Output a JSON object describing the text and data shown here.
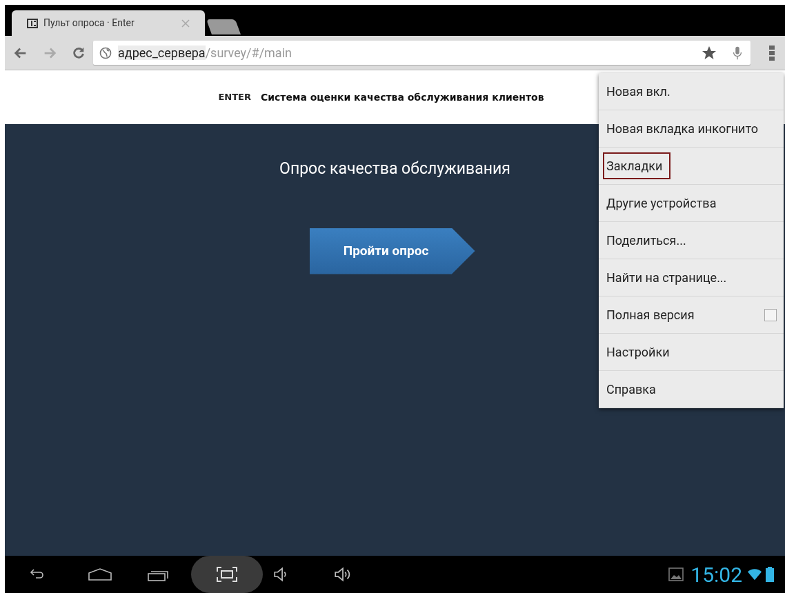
{
  "browser": {
    "tabs": [
      {
        "title": "Пульт опроса · Enter",
        "selected": true
      }
    ],
    "address": {
      "host": "адрес_сервера",
      "path": "/survey/#/main"
    }
  },
  "page": {
    "logo": "ENTER",
    "header": "Система оценки качества обслуживания клиентов",
    "title": "Опрос качества обслуживания",
    "start_button": "Пройти опрос"
  },
  "menu": {
    "items": [
      {
        "label": "Новая вкл.",
        "kind": "plain",
        "selected": false
      },
      {
        "label": "Новая вкладка инкогнито",
        "kind": "plain",
        "selected": false
      },
      {
        "label": "Закладки",
        "kind": "plain",
        "selected": true
      },
      {
        "label": "Другие устройства",
        "kind": "plain",
        "selected": false
      },
      {
        "label": "Поделиться...",
        "kind": "plain",
        "selected": false
      },
      {
        "label": "Найти на странице...",
        "kind": "plain",
        "selected": false
      },
      {
        "label": "Полная версия",
        "kind": "checkbox",
        "selected": false,
        "checked": false
      },
      {
        "label": "Настройки",
        "kind": "plain",
        "selected": false
      },
      {
        "label": "Справка",
        "kind": "plain",
        "selected": false
      }
    ]
  },
  "status_bar": {
    "time": "15:02"
  }
}
